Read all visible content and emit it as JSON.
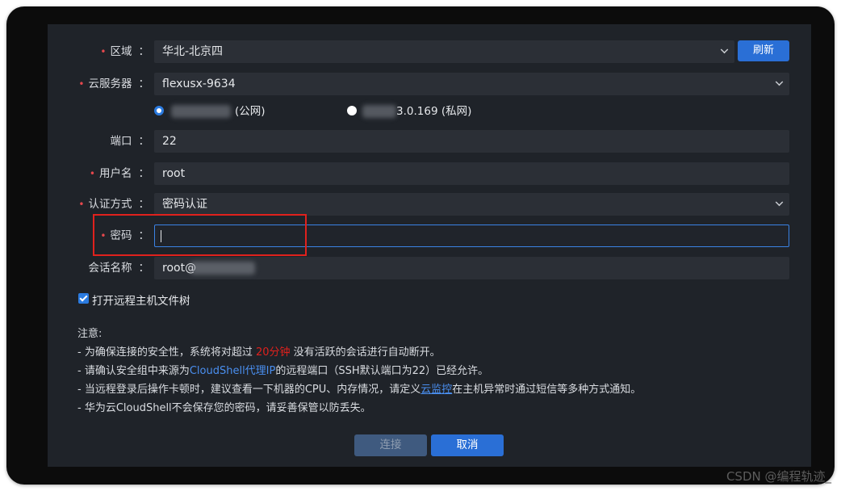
{
  "form": {
    "region": {
      "label": "区域",
      "value": "华北-北京四",
      "refresh_label": "刷新"
    },
    "server": {
      "label": "云服务器",
      "value": "flexusx-9634"
    },
    "ip_options": [
      {
        "suffix": "(公网)",
        "selected": true
      },
      {
        "suffix": "3.0.169 (私网)",
        "selected": false
      }
    ],
    "port": {
      "label": "端口",
      "value": "22"
    },
    "username": {
      "label": "用户名",
      "value": "root"
    },
    "auth": {
      "label": "认证方式",
      "value": "密码认证"
    },
    "password": {
      "label": "密码",
      "value": ""
    },
    "session": {
      "label": "会话名称",
      "value": "root@"
    },
    "colon": "："
  },
  "file_tree": {
    "label": "打开远程主机文件树",
    "checked": true
  },
  "notes": {
    "title": "注意:",
    "line1_a": "- 为确保连接的安全性，系统将对超过 ",
    "line1_red": "20分钟",
    "line1_b": " 没有活跃的会话进行自动断开。",
    "line2_a": "- 请确认安全组中来源为",
    "line2_blue": "CloudShell代理IP",
    "line2_b": "的远程端口（SSH默认端口为22）已经允许。",
    "line3_a": "- 当远程登录后操作卡顿时，建议查看一下机器的CPU、内存情况，请定义",
    "line3_link": "云监控",
    "line3_b": "在主机异常时通过短信等多种方式通知。",
    "line4": "- 华为云CloudShell不会保存您的密码，请妥善保管以防丢失。"
  },
  "buttons": {
    "connect": "连接",
    "cancel": "取消"
  },
  "watermark": "CSDN @编程轨迹_",
  "colors": {
    "accent": "#2a6fd6",
    "required": "#e5484d",
    "highlight_box": "#e0211d"
  }
}
